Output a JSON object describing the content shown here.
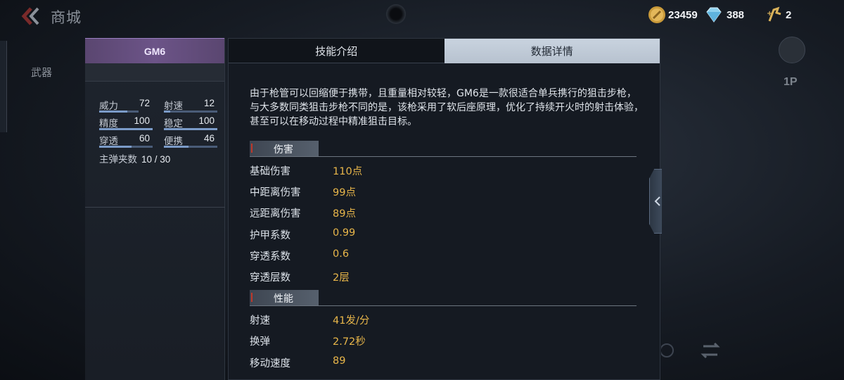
{
  "header": {
    "title": "商城",
    "coins": "23459",
    "gems": "388",
    "tickets": "2"
  },
  "background": {
    "weapon_tab": "武器",
    "perspective": "1P"
  },
  "weapon": {
    "name": "GM6",
    "stats": [
      {
        "label": "威力",
        "value": "72",
        "level": 0.72
      },
      {
        "label": "射速",
        "value": "12",
        "level": 0.12
      },
      {
        "label": "精度",
        "value": "100",
        "level": 1.0
      },
      {
        "label": "稳定",
        "value": "100",
        "level": 1.0
      },
      {
        "label": "穿透",
        "value": "60",
        "level": 0.6
      },
      {
        "label": "便携",
        "value": "46",
        "level": 0.46
      }
    ],
    "magazine_label": "主弹夹数",
    "magazine_value": "10 / 30"
  },
  "tabs": [
    {
      "label": "技能介绍",
      "active": false
    },
    {
      "label": "数据详情",
      "active": true
    }
  ],
  "description": "由于枪管可以回缩便于携带，且重量相对较轻，GM6是一款很适合单兵携行的狙击步枪，与大多数同类狙击步枪不同的是，该枪采用了软后座原理，优化了持续开火时的射击体验，甚至可以在移动过程中精准狙击目标。",
  "sections": [
    {
      "title": "伤害",
      "rows": [
        {
          "key": "基础伤害",
          "value": "110点"
        },
        {
          "key": "中距离伤害",
          "value": "99点"
        },
        {
          "key": "远距离伤害",
          "value": "89点"
        },
        {
          "key": "护甲系数",
          "value": "0.99"
        },
        {
          "key": "穿透系数",
          "value": "0.6"
        },
        {
          "key": "穿透层数",
          "value": "2层"
        }
      ]
    },
    {
      "title": "性能",
      "rows": [
        {
          "key": "射速",
          "value": "41发/分"
        },
        {
          "key": "换弹",
          "value": "2.72秒"
        },
        {
          "key": "移动速度",
          "value": "89"
        }
      ]
    }
  ],
  "colors": {
    "accent_gold": "#e8b64a",
    "header_purple": "#6c5488",
    "active_tab": "#c9d3df"
  }
}
